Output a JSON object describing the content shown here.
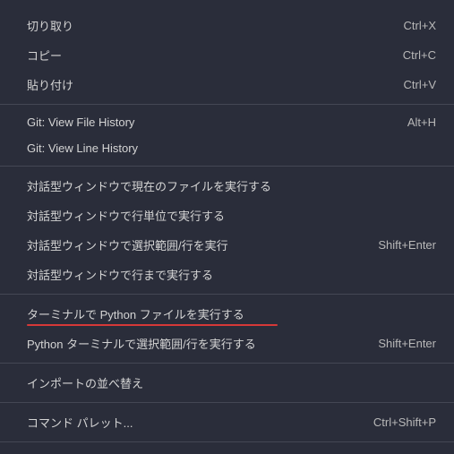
{
  "menu": {
    "group1": [
      {
        "label": "切り取り",
        "shortcut": "Ctrl+X"
      },
      {
        "label": "コピー",
        "shortcut": "Ctrl+C"
      },
      {
        "label": "貼り付け",
        "shortcut": "Ctrl+V"
      }
    ],
    "group2": [
      {
        "label": "Git: View File History",
        "shortcut": "Alt+H"
      },
      {
        "label": "Git: View Line History",
        "shortcut": ""
      }
    ],
    "group3": [
      {
        "label": "対話型ウィンドウで現在のファイルを実行する",
        "shortcut": ""
      },
      {
        "label": "対話型ウィンドウで行単位で実行する",
        "shortcut": ""
      },
      {
        "label": "対話型ウィンドウで選択範囲/行を実行",
        "shortcut": "Shift+Enter"
      },
      {
        "label": "対話型ウィンドウで行まで実行する",
        "shortcut": ""
      }
    ],
    "group4": [
      {
        "label": "ターミナルで Python ファイルを実行する",
        "shortcut": "",
        "highlighted": true
      },
      {
        "label": "Python ターミナルで選択範囲/行を実行する",
        "shortcut": "Shift+Enter"
      }
    ],
    "group5": [
      {
        "label": "インポートの並べ替え",
        "shortcut": ""
      }
    ],
    "group6": [
      {
        "label": "コマンド パレット...",
        "shortcut": "Ctrl+Shift+P"
      }
    ]
  }
}
